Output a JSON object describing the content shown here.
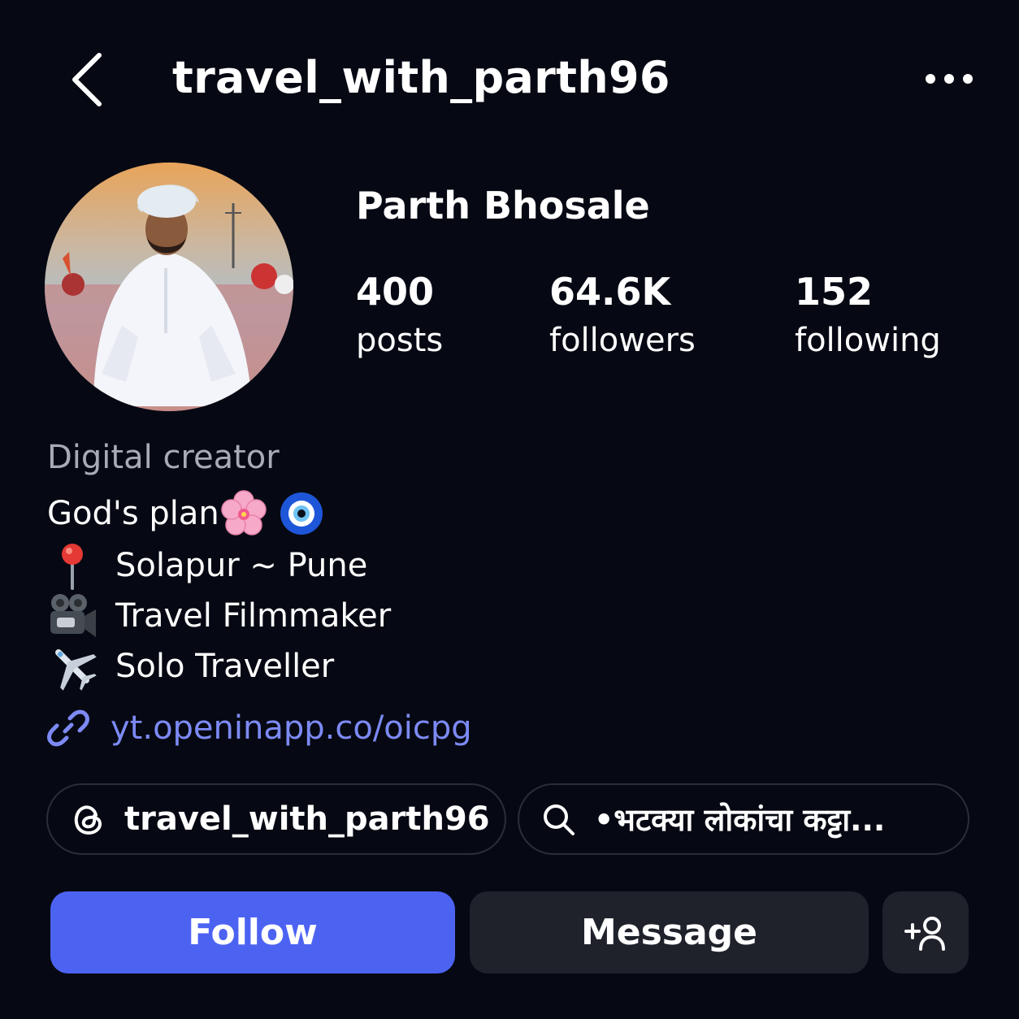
{
  "header": {
    "back_icon": "chevron-left-icon",
    "username": "travel_with_parth96",
    "more_icon": "more-horizontal-icon"
  },
  "profile": {
    "display_name": "Parth Bhosale",
    "stats": [
      {
        "count": "400",
        "label": "posts"
      },
      {
        "count": "64.6K",
        "label": "followers"
      },
      {
        "count": "152",
        "label": "following"
      }
    ]
  },
  "bio": {
    "category": "Digital creator",
    "lines": [
      {
        "icon": "",
        "text": "God's plan"
      },
      {
        "icon": "round-pushpin-icon",
        "text": "Solapur ~ Pune"
      },
      {
        "icon": "movie-camera-icon",
        "text": "Travel Filmmaker"
      },
      {
        "icon": "airplane-icon",
        "text": "Solo Traveller"
      }
    ],
    "line0_emojis": [
      "cherry-blossom-icon",
      "nazar-amulet-icon"
    ],
    "link": "yt.openinapp.co/oicpg"
  },
  "pills": {
    "threads": "travel_with_parth96",
    "search": "•भटक्या लोकांचा कट्टा..."
  },
  "actions": {
    "follow": "Follow",
    "message": "Message",
    "add_user_icon": "add-person-icon"
  },
  "colors": {
    "background": "#060913",
    "follow_button": "#4c63f2",
    "secondary_button": "#1f222b",
    "link": "#7d8af5",
    "muted_text": "#a7abb4"
  }
}
